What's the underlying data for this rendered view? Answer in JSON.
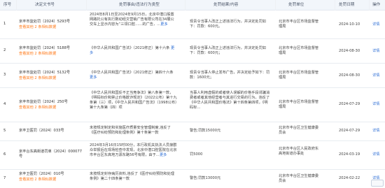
{
  "headers": {
    "num": "序号",
    "doc": "决定文书号",
    "fact": "处罚事由/违法行为类型",
    "result": "处罚结果/内容",
    "org": "处罚单位",
    "date": "处罚日期",
    "action": "操作"
  },
  "rows": [
    {
      "num": "1",
      "doc": "京丰市监处罚〔2024〕5293号",
      "links": "查看其他 2 条相似数据",
      "fact": "2024年8月1日至2024年9月15日，北京中潜口股置网路托公有执行数动经文营销广告有限公司在34展公交车上显示内容为“三领口腔……的广告，…",
      "more": "更多",
      "result": "现责令当事人改正上述违法行为，并决定处罚如下：罚款：600元。",
      "org": "北京市丰台区市场监督管理局",
      "date": "2024-10-10",
      "action": "详情"
    },
    {
      "num": "2",
      "doc": "京丰市监处罚〔2024〕5188号",
      "links": "查看其他 2 条相似数据",
      "fact": "《中华人民共和国广告法》（2021修正）第十六条",
      "more": "更多",
      "result": "现责令当事人改正上述违法行为，并决定处罚如下：罚款：600元；",
      "org": "北京市丰台区市场监督管理局",
      "date": "2024-08-30",
      "action": "详情"
    },
    {
      "num": "3",
      "doc": "京丰市监处罚〔2024〕5132号",
      "links": "查看其他 2 条相似数据",
      "fact": "《中华人民共和国广告法》（2021修正）第四十六条",
      "more": "更多",
      "result": "现责令当事人停止发布广告，并决定给予如下：罚款：1600元；",
      "org": "北京市丰台区市场监督管理局",
      "date": "2024-08-30",
      "action": "详情"
    },
    {
      "num": "4",
      "doc": "京丰市监处罚〔2024〕250号",
      "links": "查看其他 2 条相似数据",
      "fact": "《中华人民共和国反不正当竞争法》第八条第一款，《明码标价和禁止价格欺诈规定》（2022公布）第十九条第（三）项，《中华人民共和国广告法》（1998公布）第十九条第（四）项",
      "more": "",
      "result": "当事人利用虚假的或者使人误解的价格手段诱骗消费者或者其他经营者与其进行交易的行为，违反了《中华人民共和国价格法》第十四条第四项，《明码标…",
      "org": "北京市丰台区市场监督管理局",
      "date": "2024-07-29",
      "action": "详情"
    },
    {
      "num": "5",
      "doc": "京丰卫医罚〔2024〕033号",
      "links": "",
      "fact": "未按规定制定和实施医疗质量安全管理制度,违反了《医疗纠纷预防和处理条例》第十条第一款",
      "more": "",
      "result": "警告;罚款15000元",
      "org": "北京市丰台区卫生健康委员会",
      "date": "2024-07-29",
      "action": "详情"
    },
    {
      "num": "6",
      "doc": "京丰台东高街道罚单〔2024〕000077号",
      "links": "",
      "fact": "2024年3月16日15时00分，本行政机关执法人员接群众举报后在现场检查中发现，北京中潜口腔医院在北京市丰台区东高地万源东路56号有限，由于…",
      "more": "更多",
      "result": "罚5000",
      "org": "北京市丰台区人民政府东高地街道办事处",
      "date": "2024-03-19",
      "action": "详情"
    },
    {
      "num": "7",
      "doc": "京丰卫医罚〔2024〕010号",
      "links": "查看其他 2 条相似数据",
      "fact": "未按规定封存病历资料,违反了《医疗纠纷预防和处理条例》第二十四条第一款",
      "more": "",
      "result": "警告;罚款13000元",
      "org": "北京市丰台区卫生健康委员会",
      "date": "2024-02-22",
      "action": "详情"
    }
  ]
}
